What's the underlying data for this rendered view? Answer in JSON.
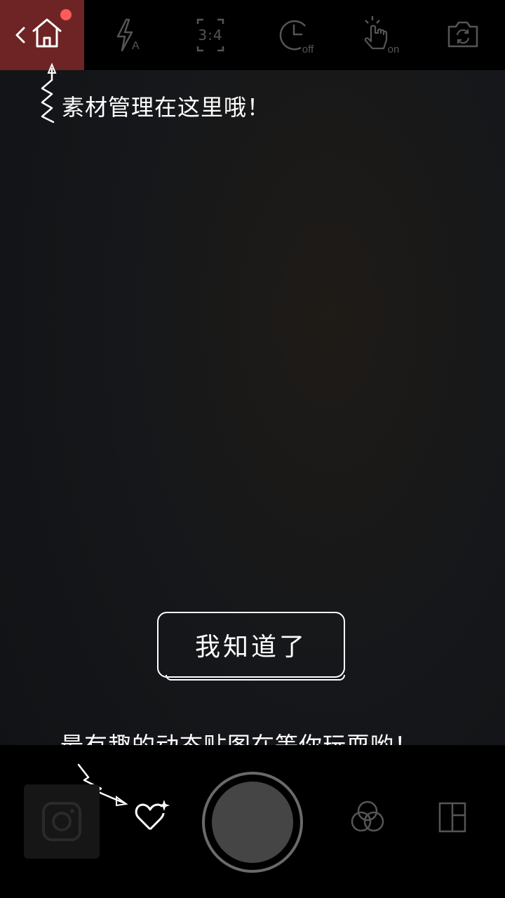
{
  "topbar": {
    "home_label": "home",
    "ratio_label": "3:4",
    "timer_state": "off",
    "touch_state": "on",
    "flash_state": "A"
  },
  "tips": {
    "top": "素材管理在这里哦！",
    "bottom": "最有趣的动态贴图在等你玩耍哟！"
  },
  "dialog": {
    "confirm_label": "我知道了"
  },
  "colors": {
    "home_highlight": "#6e2424",
    "notification_dot": "#ff5b5b",
    "icon_dim": "#555555"
  }
}
